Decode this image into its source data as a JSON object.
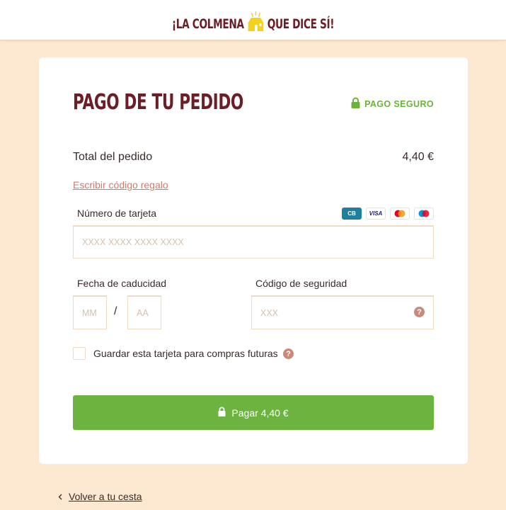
{
  "header": {
    "logo_left": "¡LA COLMENA",
    "logo_right": "QUE DICE SÍ!"
  },
  "checkout": {
    "title": "PAGO DE TU PEDIDO",
    "secure_label": "PAGO SEGURO",
    "total_label": "Total del pedido",
    "total_value": "4,40 €",
    "gift_code_link": "Escribir código regalo",
    "card_number_label": "Número de tarjeta",
    "card_logos": [
      "CB",
      "VISA",
      "mastercard",
      "Maestro"
    ],
    "card_number_placeholder": "XXXX XXXX XXXX XXXX",
    "expiry_label": "Fecha de caducidad",
    "expiry_month_placeholder": "MM",
    "expiry_separator": "/",
    "expiry_year_placeholder": "AA",
    "cvv_label": "Código de seguridad",
    "cvv_placeholder": "XXX",
    "save_card_label": "Guardar esta tarjeta para compras futuras",
    "pay_button_label": "Pagar 4,40 €"
  },
  "footer": {
    "back_link": "Volver a tu cesta"
  },
  "colors": {
    "brand": "#6b1e26",
    "accent_green": "#6cb33f",
    "page_bg": "#fde9d2",
    "link": "#d07a6a",
    "logo_yellow": "#f2d21e"
  },
  "icons": {
    "help": "question-circle-icon",
    "lock": "lock-icon",
    "back": "chevron-left-icon"
  }
}
